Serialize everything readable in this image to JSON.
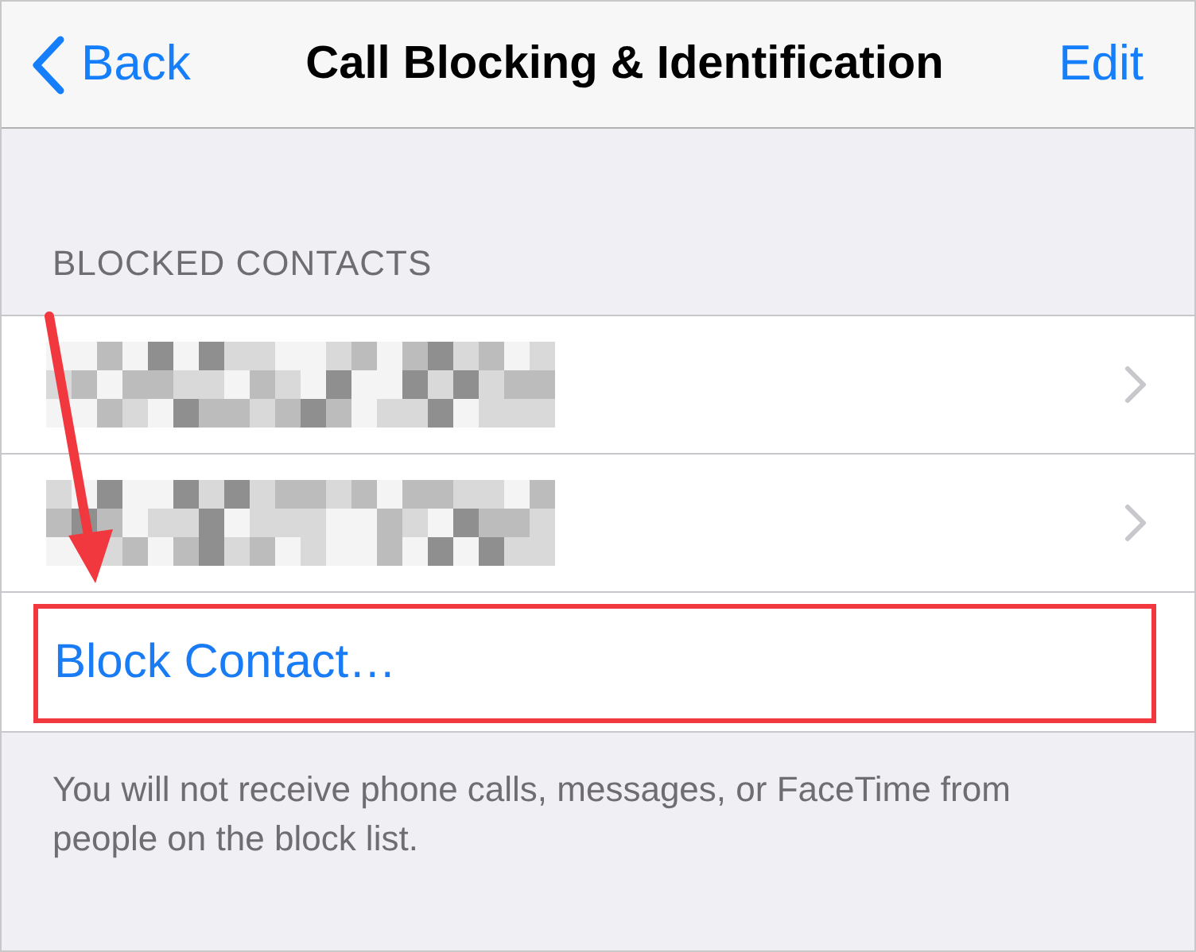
{
  "nav": {
    "back": "Back",
    "title": "Call Blocking & Identification",
    "edit": "Edit"
  },
  "section": {
    "header": "BLOCKED CONTACTS",
    "rows": [
      {
        "kind": "redacted",
        "highlighted": false
      },
      {
        "kind": "redacted",
        "highlighted": false
      },
      {
        "kind": "action",
        "label": "Block Contact…",
        "highlighted": true
      }
    ],
    "footer": "You will not receive phone calls, messages, or FaceTime from people on the block list."
  }
}
